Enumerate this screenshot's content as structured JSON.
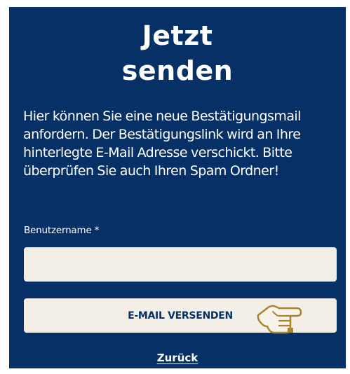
{
  "colors": {
    "panel_background": "#063066",
    "field_background": "#f2eee7",
    "button_background": "#f3efe7",
    "button_text": "#063066",
    "text": "#ffffff",
    "hand_icon_outline": "#a9852d"
  },
  "form": {
    "title_line1": "Jetzt",
    "title_line2": "senden",
    "description": "Hier können Sie eine neue Bestätigungsmail anfordern. Der Bestätigungslink wird an Ihre hinterlegte E-Mail Adresse verschickt. Bitte überprüfen Sie auch Ihren Spam Ordner!",
    "username_label": "Benutzername",
    "required_marker": "*",
    "username_value": "",
    "submit_label": "E-MAIL VERSENDEN",
    "back_link_label": "Zurück"
  },
  "icons": {
    "pointer": "pointing-hand-icon"
  }
}
